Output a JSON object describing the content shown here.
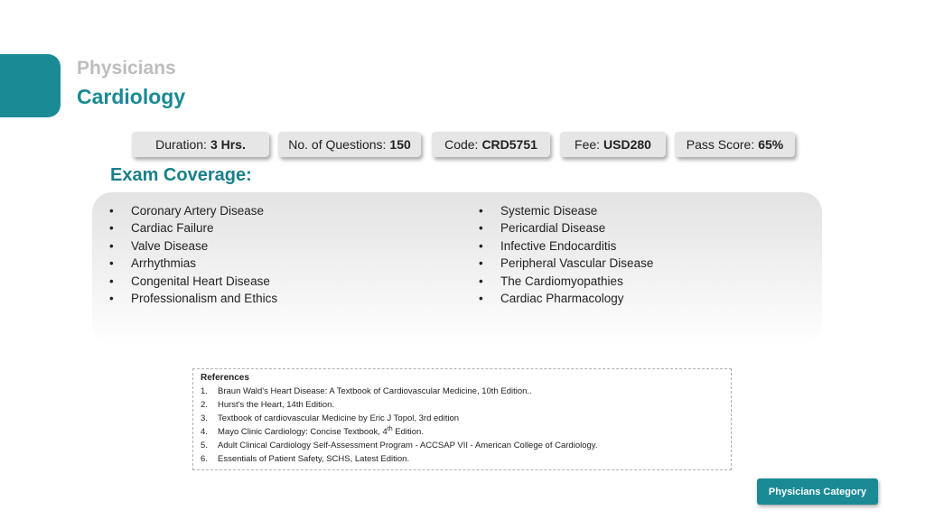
{
  "header": {
    "category": "Physicians",
    "title": "Cardiology"
  },
  "exam_info": [
    {
      "label": "Duration:",
      "value": "3 Hrs."
    },
    {
      "label": "No. of Questions:",
      "value": "150"
    },
    {
      "label": "Code:",
      "value": "CRD5751"
    },
    {
      "label": "Fee:",
      "value": "USD280"
    },
    {
      "label": "Pass Score:",
      "value": "65%"
    }
  ],
  "coverage": {
    "title": "Exam Coverage:",
    "bullet": "•",
    "left": [
      "Coronary Artery Disease",
      "Cardiac Failure",
      "Valve Disease",
      "Arrhythmias",
      "Congenital Heart Disease",
      "Professionalism and Ethics"
    ],
    "right": [
      "Systemic Disease",
      "Pericardial Disease",
      "Infective Endocarditis",
      "Peripheral Vascular Disease",
      "The Cardiomyopathies",
      "Cardiac Pharmacology"
    ]
  },
  "references": {
    "title": "References",
    "items": [
      {
        "num": "1.",
        "text": "Braun Wald's Heart Disease: A Textbook of Cardiovascular Medicine, 10th Edition.."
      },
      {
        "num": "2.",
        "text": "Hurst's the Heart, 14th Edition."
      },
      {
        "num": "3.",
        "text": "Textbook of cardiovascular Medicine by Eric J Topol, 3rd edition"
      },
      {
        "num": "4.",
        "text_before": "Mayo Clinic Cardiology: Concise Textbook, 4",
        "sup": "th",
        "text_after": " Edition."
      },
      {
        "num": "5.",
        "text": "Adult Clinical Cardiology Self-Assessment Program - ACCSAP VII - American College of Cardiology."
      },
      {
        "num": "6.",
        "text": "Essentials of Patient Safety, SCHS, Latest Edition."
      }
    ]
  },
  "footer": {
    "button_label": "Physicians Category"
  },
  "colors": {
    "accent": "#1a8a94",
    "category_text": "#bdbdbd",
    "pill_bg": "#e6e6e6"
  }
}
